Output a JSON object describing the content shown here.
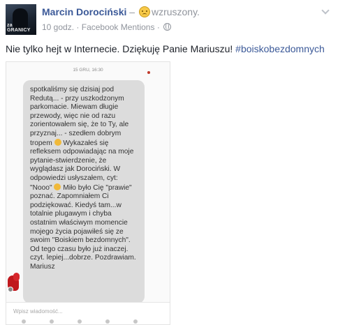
{
  "post": {
    "author": "Marcin Dorociński",
    "dash": "–",
    "feeling": "wzruszony.",
    "time": "10 godz.",
    "separator": "·",
    "source": "Facebook Mentions",
    "privacy_separator": "·",
    "text": "Nie tylko hejt w Internecie. Dziękuję Panie Mariuszu!",
    "hashtag": "#boiskobezdomnych",
    "avatar_caption": "za GRANICY",
    "icons": [
      "feeling-emoji-icon",
      "globe-icon",
      "chevron-down-icon"
    ]
  },
  "screenshot": {
    "date": "15 GRU, 16:30",
    "message_parts": [
      "spotkaliśmy się dzisiaj pod Redutą... - przy uszkodzonym parkomacie. Miewam długie przewody, więc nie od razu zorientowałem się, że to Ty, ale przyznaj... - szedłem dobrym tropem",
      "Wykazałeś się refleksem odpowiadając na moje pytanie-stwierdzenie, że wyglądasz jak Dorociński. W odpowiedzi usłyszałem, cyt: \"Nooo\"",
      "Miło było Cię \"prawie\" poznać. Zapomniałem Ci podziękować. Kiedyś tam...w totalnie plugawym i chyba ostatnim właściwym momencie mojego życia pojawiłeś się ze swoim \"Boiskiem bezdomnych\". Od tego czasu było już inaczej. czyt. lepiej...dobrze. Pozdrawiam. Mariusz"
    ],
    "compose_placeholder": "Wpisz wiadomość..."
  },
  "colors": {
    "link": "#3b5998",
    "meta": "#90949c",
    "bubble": "#dcdcdc"
  }
}
